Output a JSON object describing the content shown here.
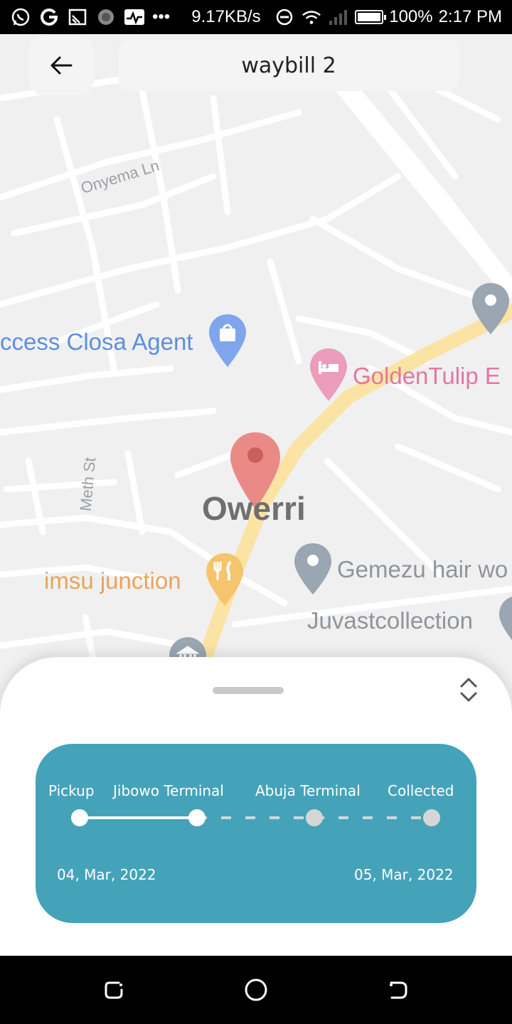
{
  "status_bar": {
    "speed": "9.17KB/s",
    "battery": "100%",
    "battery_level": 1.0,
    "time": "2:17 PM",
    "icons": [
      "whatsapp-icon",
      "google-icon",
      "cast-icon",
      "app-icon",
      "activity-icon",
      "more-icon",
      "dnd-icon",
      "wifi-icon",
      "signal-icon",
      "battery-icon"
    ]
  },
  "header": {
    "title": "waybill 2",
    "back_icon": "arrow-left-icon"
  },
  "map": {
    "streets": [
      "Onyema Ln",
      "Meth St"
    ],
    "pois": [
      "ccess Closa Agent",
      "GoldenTulip E",
      "imsu junction",
      "Gemezu hair wo",
      "Juvastcollection"
    ],
    "city": "Owerri",
    "colors": {
      "marker": "#ea8a86",
      "road": "#fbe3a4",
      "pink_poi": "#e3779f",
      "blue_poi": "#5e8fde",
      "orange_poi": "#f5c46d"
    }
  },
  "sheet": {
    "handle_icon": "drag-handle-icon",
    "expand_icon": "unfold-icon",
    "card_color": "#45a3b9",
    "stops": [
      "Pickup",
      "Jibowo Terminal",
      "Abuja Terminal",
      "Collected"
    ],
    "stops_completed": 2,
    "start_date": "04, Mar, 2022",
    "end_date": "05, Mar, 2022"
  },
  "nav_bar": {
    "buttons": [
      "recent-apps-icon",
      "home-icon",
      "back-icon"
    ]
  }
}
